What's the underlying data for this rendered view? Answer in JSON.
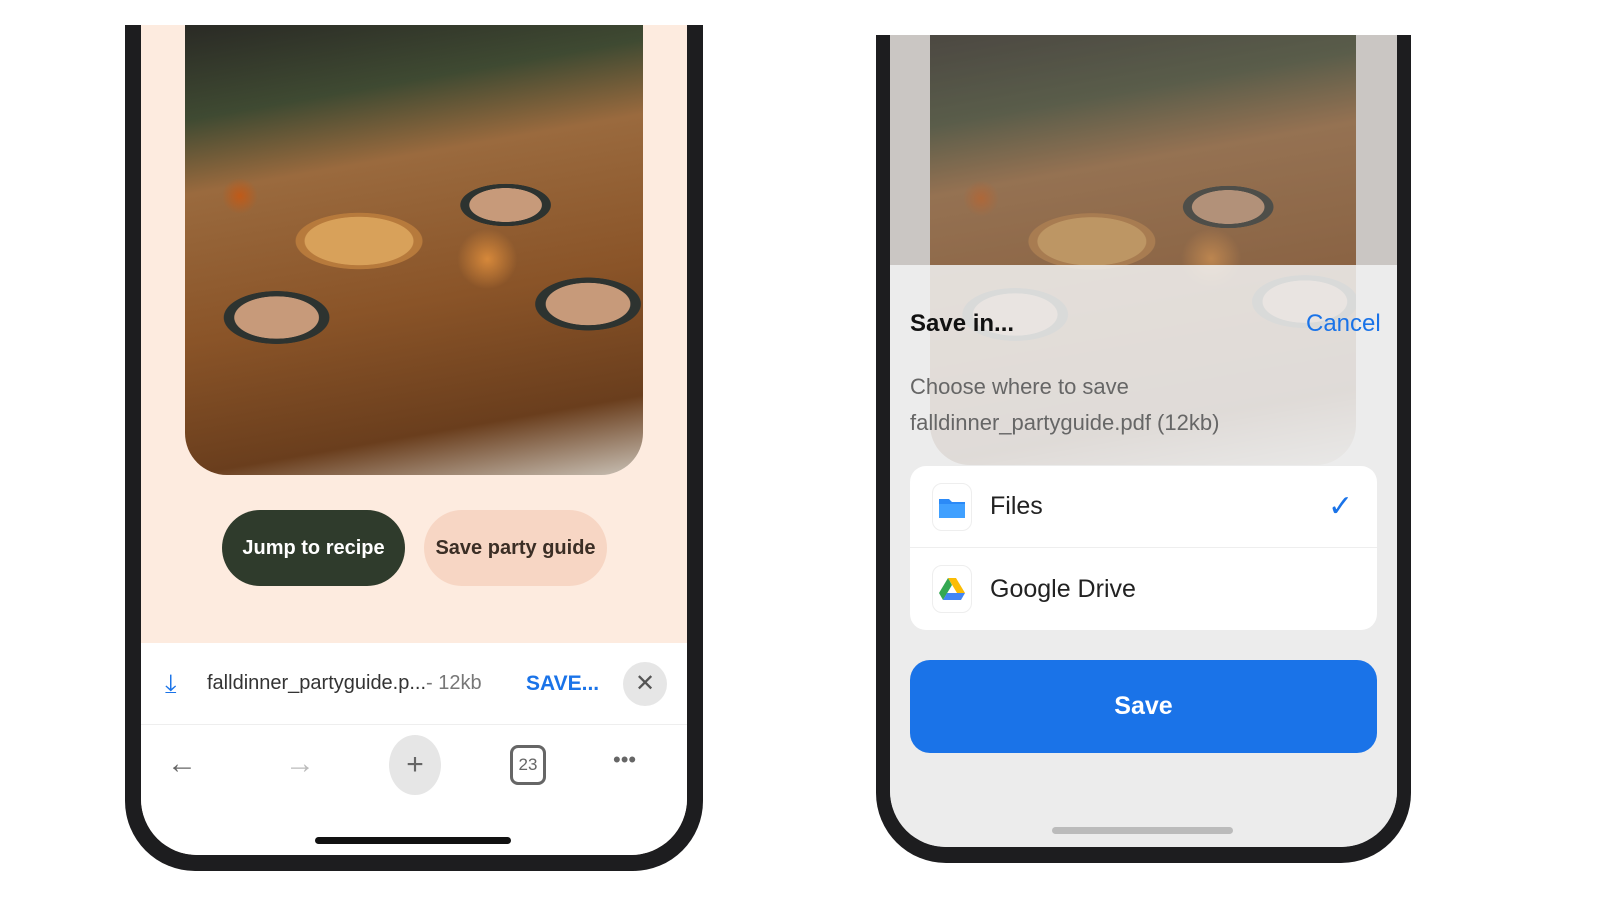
{
  "left_phone": {
    "buttons": {
      "jump": "Jump to recipe",
      "save_guide": "Save party guide"
    },
    "download_bar": {
      "filename": "falldinner_partyguide.p...",
      "size": "- 12kb",
      "save": "SAVE...",
      "close": "✕"
    },
    "nav": {
      "back": "←",
      "forward": "→",
      "new_tab": "+",
      "tab_count": "23",
      "menu": "•••"
    }
  },
  "right_phone": {
    "sheet": {
      "title": "Save in...",
      "cancel": "Cancel",
      "line1": "Choose where to save",
      "line2": "falldinner_partyguide.pdf (12kb)",
      "options": [
        {
          "label": "Files",
          "selected": true
        },
        {
          "label": "Google Drive",
          "selected": false
        }
      ],
      "check": "✓",
      "save": "Save"
    }
  },
  "colors": {
    "accent": "#1a73e8",
    "dark_button": "#2f3b2c",
    "peach_button": "#f7d6c4",
    "page_bg": "#fdebdf"
  }
}
